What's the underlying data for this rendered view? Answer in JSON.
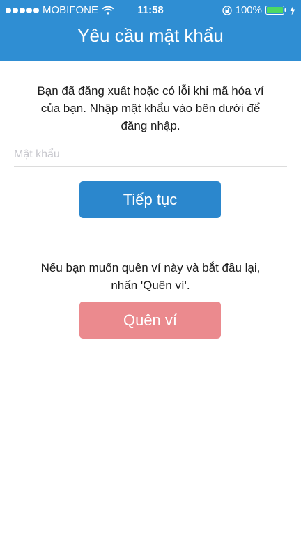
{
  "status_bar": {
    "carrier": "MOBIFONE",
    "time": "11:58",
    "battery": "100%"
  },
  "header": {
    "title": "Yêu cầu mật khẩu"
  },
  "main": {
    "info_line1": "Bạn đã đăng xuất hoặc có lỗi khi mã hóa ví",
    "info_line2": "của bạn. Nhập mật khẩu vào bên dưới để",
    "info_line3": "đăng nhập.",
    "password_placeholder": "Mật khẩu",
    "password_value": "",
    "continue_label": "Tiếp tục",
    "forget_line1": "Nếu bạn muốn quên ví này và bắt đầu lại,",
    "forget_line2": "nhấn 'Quên ví'.",
    "forget_label": "Quên ví"
  },
  "icons": {
    "wifi": "wifi-icon",
    "lock": "orientation-lock-icon",
    "battery": "battery-icon",
    "charging": "charging-bolt-icon"
  },
  "colors": {
    "header": "#2f8ed3",
    "continue_button": "#2b87cd",
    "forget_button": "#eb8a8e",
    "battery_fill": "#4cd964"
  }
}
